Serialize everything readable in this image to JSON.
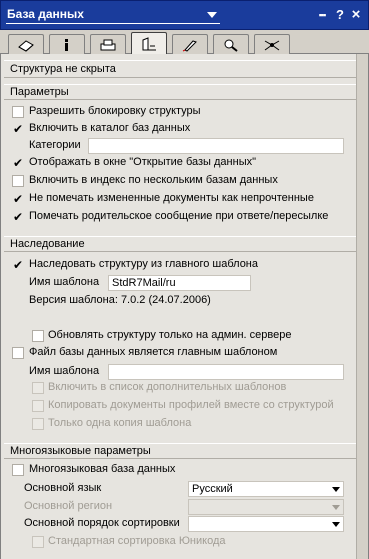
{
  "title": "База данных",
  "titlebar_buttons": [
    "▪▪▪",
    "?",
    "×"
  ],
  "tabs": [
    {
      "icon": "info-db-icon"
    },
    {
      "icon": "info-i-icon"
    },
    {
      "icon": "printer-icon"
    },
    {
      "icon": "design-icon"
    },
    {
      "icon": "rocket-icon"
    },
    {
      "icon": "search-icon"
    },
    {
      "icon": "advanced-icon"
    }
  ],
  "status": "Структура не скрыта",
  "params": {
    "header": "Параметры",
    "allow_lock": "Разрешить блокировку структуры",
    "include_catalog": "Включить в каталог баз данных",
    "categories_label": "Категории",
    "categories_value": "",
    "show_open_db": "Отображать в окне \"Открытие базы данных\"",
    "include_multi_index": "Включить в индекс по нескольким базам данных",
    "dont_mark_unread": "Не помечать измененные документы как непрочтенные",
    "mark_parent": "Помечать родительское сообщение при ответе/пересылке"
  },
  "inherit": {
    "header": "Наследование",
    "inherit_template": "Наследовать структуру из главного шаблона",
    "template_name_label": "Имя шаблона",
    "template_name_value": "StdR7Mail/ru",
    "template_version": "Версия шаблона: 7.0.2 (24.07.2006)",
    "update_admin_only": "Обновлять структуру только на админ. сервере",
    "is_master_template": "Файл базы данных является главным шаблоном",
    "master_name_label": "Имя шаблона",
    "master_name_value": "",
    "list_additional": "Включить в список дополнительных шаблонов",
    "copy_profile_docs": "Копировать документы профилей вместе со структурой",
    "single_copy": "Только одна копия шаблона"
  },
  "multilang": {
    "header": "Многоязыковые параметры",
    "multilang_db": "Многоязыковая база данных",
    "main_lang_label": "Основной язык",
    "main_lang_value": "Русский",
    "main_region_label": "Основной регион",
    "main_region_value": "",
    "sort_order_label": "Основной порядок сортировки",
    "sort_order_value": "",
    "std_unicode_sort": "Стандартная сортировка Юникода"
  },
  "colors": {
    "titlebar": "#1a3c9c",
    "panel": "#e6e4df",
    "disabled_text": "#a09c94"
  }
}
